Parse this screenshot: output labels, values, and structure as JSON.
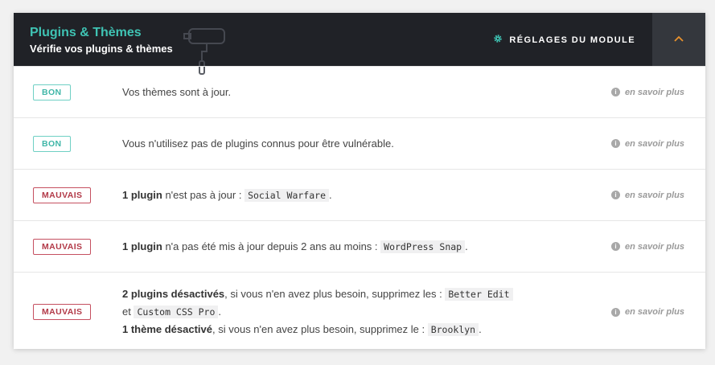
{
  "header": {
    "title": "Plugins & Thèmes",
    "subtitle": "Vérifie vos plugins & thèmes",
    "settings_label": "RÉGLAGES DU MODULE",
    "accent_color": "#3fc4b4",
    "bg_color": "#202227"
  },
  "rows": [
    {
      "badge": "BON",
      "status": "good",
      "text": "Vos thèmes sont à jour.",
      "more": "en savoir plus"
    },
    {
      "badge": "BON",
      "status": "good",
      "text": "Vous n'utilisez pas de plugins connus pour être vulnérable.",
      "more": "en savoir plus"
    },
    {
      "badge": "MAUVAIS",
      "status": "bad",
      "strong": "1 plugin",
      "text": " n'est pas à jour : ",
      "code": "Social Warfare",
      "end": ".",
      "more": "en savoir plus"
    },
    {
      "badge": "MAUVAIS",
      "status": "bad",
      "strong": "1 plugin",
      "text": " n'a pas été mis à jour depuis 2 ans au moins : ",
      "code": "WordPress Snap",
      "end": ".",
      "more": "en savoir plus"
    },
    {
      "badge": "MAUVAIS",
      "status": "bad",
      "strong1": "2 plugins désactivés",
      "text1": ", si vous n'en avez plus besoin, supprimez les : ",
      "code1": "Better Edit",
      "and": " et ",
      "code2": "Custom CSS Pro",
      "end1": ".",
      "strong2": "1 thème désactivé",
      "text2": ", si vous n'en avez plus besoin, supprimez le : ",
      "code3": "Brooklyn",
      "end2": ".",
      "more": "en savoir plus"
    }
  ]
}
